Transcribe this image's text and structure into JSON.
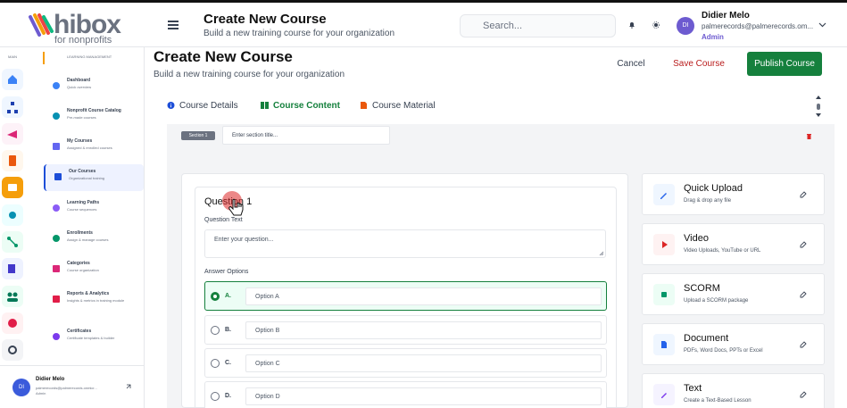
{
  "brand": {
    "logo_word": "hibox",
    "logo_tagline": "for nonprofits"
  },
  "topbar": {
    "title": "Create New Course",
    "subtitle": "Build a new training course for your organization",
    "search_placeholder": "Search...",
    "user_initials": "DI",
    "user_name": "Didier Melo",
    "user_email": "palmerecords@palmerecords.om...",
    "user_role": "Admin"
  },
  "sidebar": {
    "section_main": "MAIN",
    "section_lm": "LEARNING MANAGEMENT",
    "items": [
      {
        "label": "Dashboard",
        "sub": "Quick overview",
        "color": "#3b82f6"
      },
      {
        "label": "Nonprofit Course Catalog",
        "sub": "Pre-made courses",
        "color": "#0891b2"
      },
      {
        "label": "My Courses",
        "sub": "Assigned & enrolled courses",
        "color": "#6366f1"
      },
      {
        "label": "Our Courses",
        "sub": "Organizational training",
        "color": "#1d4ed8"
      },
      {
        "label": "Learning Paths",
        "sub": "Course sequences",
        "color": "#8b5cf6"
      },
      {
        "label": "Enrollments",
        "sub": "Assign & manage courses",
        "color": "#059669"
      },
      {
        "label": "Categories",
        "sub": "Course organization",
        "color": "#db2777"
      },
      {
        "label": "Reports & Analytics",
        "sub": "Insights & metrics in training module",
        "color": "#e11d48"
      },
      {
        "label": "Certificates",
        "sub": "Certificate templates & builder",
        "color": "#7c3aed"
      }
    ],
    "footer": {
      "initials": "DI",
      "name": "Didier Melo",
      "email": "palmerecords@palmerecords.onmicr...",
      "role": "Admin"
    }
  },
  "page": {
    "title": "Create New Course",
    "subtitle": "Build a new training course for your organization",
    "cancel": "Cancel",
    "save": "Save Course",
    "publish": "Publish Course"
  },
  "tabs": [
    {
      "label": "Course Details",
      "icon": "info-icon"
    },
    {
      "label": "Course Content",
      "icon": "book-icon"
    },
    {
      "label": "Course Material",
      "icon": "file-icon"
    }
  ],
  "section": {
    "badge": "Section 1",
    "placeholder": "Enter section title..."
  },
  "question": {
    "title": "Question 1",
    "text_label": "Question Text",
    "text_placeholder": "Enter your question...",
    "options_label": "Answer Options",
    "options": [
      {
        "letter": "A.",
        "placeholder": "Option A",
        "selected": true
      },
      {
        "letter": "B.",
        "placeholder": "Option B",
        "selected": false
      },
      {
        "letter": "C.",
        "placeholder": "Option C",
        "selected": false
      },
      {
        "letter": "D.",
        "placeholder": "Option D",
        "selected": false
      }
    ]
  },
  "content_types": [
    {
      "title": "Quick Upload",
      "sub": "Drag & drop any file",
      "icon": "pencil-icon",
      "color": "#2563eb",
      "bg": "#eff6ff"
    },
    {
      "title": "Video",
      "sub": "Video Uploads, YouTube or URL",
      "icon": "play-icon",
      "color": "#dc2626",
      "bg": "#fef2f2"
    },
    {
      "title": "SCORM",
      "sub": "Upload a SCORM package",
      "icon": "package-icon",
      "color": "#059669",
      "bg": "#ecfdf5"
    },
    {
      "title": "Document",
      "sub": "PDFs, Word Docs, PPTs or Excel",
      "icon": "document-icon",
      "color": "#2563eb",
      "bg": "#eff6ff"
    },
    {
      "title": "Text",
      "sub": "Create a Text-Based Lesson",
      "icon": "text-icon",
      "color": "#7c3aed",
      "bg": "#f5f3ff"
    }
  ]
}
